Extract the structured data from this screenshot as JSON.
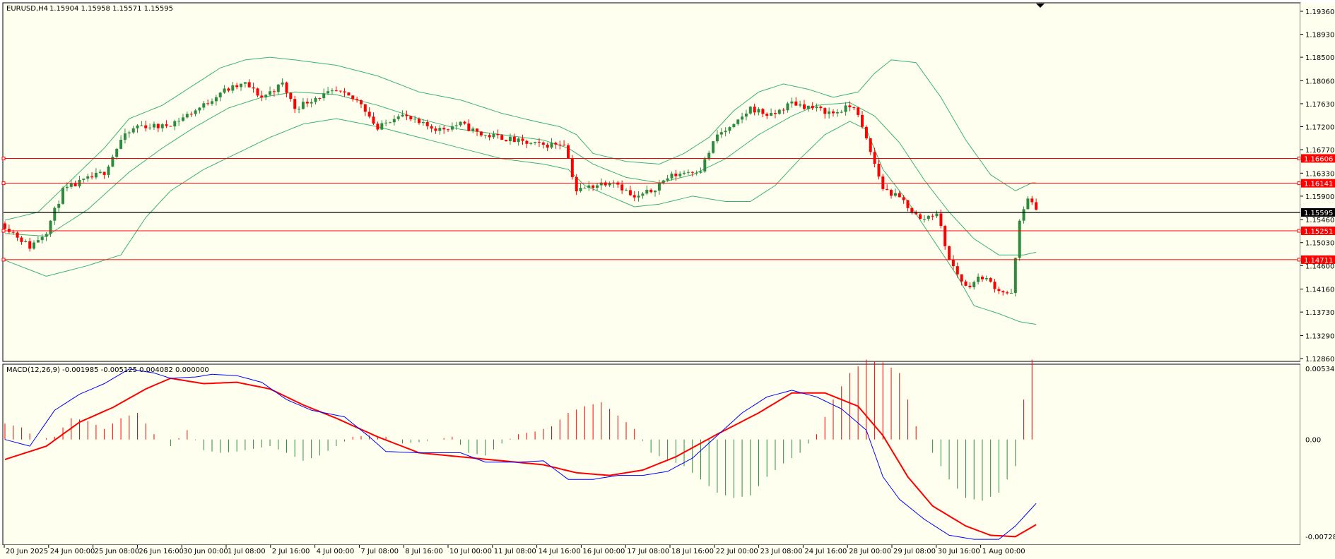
{
  "chart_data": [
    {
      "type": "candlestick",
      "title": "EURUSD,H4",
      "ohlc_readout": [
        "1.15904",
        "1.15958",
        "1.15571",
        "1.15595"
      ],
      "price_ticks": [
        "1.19360",
        "1.18930",
        "1.18500",
        "1.18060",
        "1.17630",
        "1.17200",
        "1.16770",
        "1.16330",
        "1.15900",
        "1.15460",
        "1.15030",
        "1.14600",
        "1.14160",
        "1.13730",
        "1.13290",
        "1.12860"
      ],
      "ylim": [
        1.1286,
        1.1936
      ],
      "horizontal_levels": [
        {
          "price": 1.16606,
          "label": "1.16606",
          "color": "#ff0000"
        },
        {
          "price": 1.16141,
          "label": "1.16141",
          "color": "#ff0000"
        },
        {
          "price": 1.15251,
          "label": "1.15251",
          "color": "#ff0000"
        },
        {
          "price": 1.14711,
          "label": "1.14711",
          "color": "#ff0000"
        }
      ],
      "current_price": {
        "price": 1.15595,
        "label": "1.15595",
        "color": "#000000"
      },
      "colors": {
        "up": "#2e8b3e",
        "down": "#ff0000",
        "bands": "#3cb371",
        "background": "#fffff0"
      },
      "x_labels": [
        "20 Jun 2025",
        "24 Jun 00:00",
        "25 Jun 08:00",
        "26 Jun 16:00",
        "30 Jun 00:00",
        "1 Jul 08:00",
        "2 Jul 16:00",
        "4 Jul 00:00",
        "7 Jul 08:00",
        "8 Jul 16:00",
        "10 Jul 00:00",
        "11 Jul 08:00",
        "14 Jul 16:00",
        "16 Jul 00:00",
        "17 Jul 08:00",
        "18 Jul 16:00",
        "22 Jul 00:00",
        "23 Jul 08:00",
        "24 Jul 16:00",
        "28 Jul 00:00",
        "29 Jul 08:00",
        "30 Jul 16:00",
        "1 Aug 00:00"
      ],
      "close_path": [
        [
          0,
          1.1535
        ],
        [
          6,
          1.1495
        ],
        [
          10,
          1.1525
        ],
        [
          14,
          1.16
        ],
        [
          18,
          1.1615
        ],
        [
          24,
          1.1635
        ],
        [
          28,
          1.1695
        ],
        [
          32,
          1.1722
        ],
        [
          38,
          1.172
        ],
        [
          42,
          1.1733
        ],
        [
          48,
          1.176
        ],
        [
          52,
          1.1785
        ],
        [
          58,
          1.18
        ],
        [
          62,
          1.1775
        ],
        [
          67,
          1.18
        ],
        [
          70,
          1.1755
        ],
        [
          75,
          1.1775
        ],
        [
          80,
          1.1785
        ],
        [
          86,
          1.1765
        ],
        [
          90,
          1.1715
        ],
        [
          95,
          1.1745
        ],
        [
          100,
          1.1725
        ],
        [
          105,
          1.1715
        ],
        [
          110,
          1.1725
        ],
        [
          115,
          1.1705
        ],
        [
          120,
          1.17
        ],
        [
          125,
          1.169
        ],
        [
          130,
          1.1685
        ],
        [
          135,
          1.169
        ],
        [
          138,
          1.16
        ],
        [
          142,
          1.161
        ],
        [
          147,
          1.162
        ],
        [
          152,
          1.1585
        ],
        [
          156,
          1.16
        ],
        [
          160,
          1.1625
        ],
        [
          164,
          1.1635
        ],
        [
          168,
          1.164
        ],
        [
          172,
          1.1705
        ],
        [
          176,
          1.172
        ],
        [
          180,
          1.1755
        ],
        [
          185,
          1.174
        ],
        [
          190,
          1.1765
        ],
        [
          195,
          1.1755
        ],
        [
          200,
          1.1745
        ],
        [
          205,
          1.176
        ],
        [
          208,
          1.1695
        ],
        [
          212,
          1.1605
        ],
        [
          217,
          1.158
        ],
        [
          221,
          1.1545
        ],
        [
          225,
          1.156
        ],
        [
          228,
          1.147
        ],
        [
          232,
          1.142
        ],
        [
          236,
          1.144
        ],
        [
          240,
          1.1415
        ],
        [
          243,
          1.1405
        ],
        [
          245,
          1.154
        ],
        [
          247,
          1.159
        ],
        [
          249,
          1.156
        ]
      ],
      "upper_band_path": [
        [
          0,
          1.1545
        ],
        [
          8,
          1.156
        ],
        [
          16,
          1.162
        ],
        [
          24,
          1.168
        ],
        [
          30,
          1.1735
        ],
        [
          38,
          1.176
        ],
        [
          46,
          1.18
        ],
        [
          52,
          1.183
        ],
        [
          58,
          1.1845
        ],
        [
          64,
          1.185
        ],
        [
          70,
          1.1845
        ],
        [
          80,
          1.1835
        ],
        [
          90,
          1.1815
        ],
        [
          100,
          1.1785
        ],
        [
          110,
          1.177
        ],
        [
          120,
          1.1745
        ],
        [
          128,
          1.173
        ],
        [
          134,
          1.172
        ],
        [
          138,
          1.1705
        ],
        [
          142,
          1.167
        ],
        [
          150,
          1.1655
        ],
        [
          158,
          1.165
        ],
        [
          164,
          1.167
        ],
        [
          170,
          1.17
        ],
        [
          176,
          1.175
        ],
        [
          182,
          1.1785
        ],
        [
          188,
          1.18
        ],
        [
          194,
          1.179
        ],
        [
          200,
          1.1775
        ],
        [
          206,
          1.1785
        ],
        [
          210,
          1.182
        ],
        [
          214,
          1.1845
        ],
        [
          220,
          1.184
        ],
        [
          226,
          1.1775
        ],
        [
          232,
          1.1695
        ],
        [
          238,
          1.163
        ],
        [
          244,
          1.16
        ],
        [
          248,
          1.1615
        ]
      ],
      "middle_band_path": [
        [
          0,
          1.152
        ],
        [
          10,
          1.1515
        ],
        [
          20,
          1.1565
        ],
        [
          30,
          1.1635
        ],
        [
          38,
          1.168
        ],
        [
          46,
          1.172
        ],
        [
          54,
          1.1755
        ],
        [
          62,
          1.1775
        ],
        [
          70,
          1.1785
        ],
        [
          80,
          1.178
        ],
        [
          90,
          1.176
        ],
        [
          100,
          1.1735
        ],
        [
          110,
          1.1715
        ],
        [
          120,
          1.1705
        ],
        [
          130,
          1.1695
        ],
        [
          136,
          1.168
        ],
        [
          142,
          1.165
        ],
        [
          150,
          1.1625
        ],
        [
          158,
          1.1615
        ],
        [
          166,
          1.163
        ],
        [
          174,
          1.166
        ],
        [
          182,
          1.1705
        ],
        [
          190,
          1.174
        ],
        [
          196,
          1.176
        ],
        [
          204,
          1.1765
        ],
        [
          210,
          1.174
        ],
        [
          216,
          1.169
        ],
        [
          222,
          1.162
        ],
        [
          228,
          1.156
        ],
        [
          234,
          1.151
        ],
        [
          240,
          1.148
        ],
        [
          246,
          1.148
        ],
        [
          249,
          1.1485
        ]
      ],
      "lower_band_path": [
        [
          0,
          1.147
        ],
        [
          10,
          1.144
        ],
        [
          20,
          1.146
        ],
        [
          28,
          1.148
        ],
        [
          34,
          1.155
        ],
        [
          40,
          1.16
        ],
        [
          48,
          1.164
        ],
        [
          56,
          1.167
        ],
        [
          64,
          1.17
        ],
        [
          72,
          1.1725
        ],
        [
          80,
          1.1735
        ],
        [
          90,
          1.172
        ],
        [
          100,
          1.17
        ],
        [
          110,
          1.168
        ],
        [
          120,
          1.166
        ],
        [
          130,
          1.165
        ],
        [
          136,
          1.164
        ],
        [
          140,
          1.161
        ],
        [
          146,
          1.159
        ],
        [
          152,
          1.157
        ],
        [
          158,
          1.1575
        ],
        [
          166,
          1.159
        ],
        [
          174,
          1.158
        ],
        [
          180,
          1.158
        ],
        [
          186,
          1.161
        ],
        [
          192,
          1.166
        ],
        [
          198,
          1.1705
        ],
        [
          204,
          1.173
        ],
        [
          208,
          1.1715
        ],
        [
          212,
          1.164
        ],
        [
          218,
          1.158
        ],
        [
          224,
          1.151
        ],
        [
          230,
          1.144
        ],
        [
          234,
          1.1385
        ],
        [
          240,
          1.137
        ],
        [
          245,
          1.1355
        ],
        [
          249,
          1.135
        ]
      ],
      "bar_count": 250
    },
    {
      "type": "macd",
      "title": "MACD(12,26,9) -0.001985 -0.005125 0.004082 0.000000",
      "y_ticks": [
        "0.005342",
        "0.00",
        "-0.007285"
      ],
      "ylim": [
        -0.007285,
        0.005342
      ],
      "colors": {
        "main": "#0000ff",
        "signal": "#ff0000",
        "hist_pos": "#ff0000",
        "hist_neg": "#2e8b3e"
      },
      "main_path": [
        [
          0,
          0.0
        ],
        [
          6,
          -0.0005
        ],
        [
          12,
          0.0022
        ],
        [
          18,
          0.0034
        ],
        [
          24,
          0.0042
        ],
        [
          30,
          0.0053
        ],
        [
          36,
          0.005
        ],
        [
          40,
          0.0046
        ],
        [
          46,
          0.0047
        ],
        [
          50,
          0.0049
        ],
        [
          56,
          0.0048
        ],
        [
          62,
          0.0043
        ],
        [
          68,
          0.003
        ],
        [
          74,
          0.0022
        ],
        [
          82,
          0.0017
        ],
        [
          88,
          0.0002
        ],
        [
          92,
          -0.0009
        ],
        [
          100,
          -0.001
        ],
        [
          110,
          -0.001
        ],
        [
          116,
          -0.0017
        ],
        [
          124,
          -0.0017
        ],
        [
          130,
          -0.0016
        ],
        [
          136,
          -0.003
        ],
        [
          142,
          -0.003
        ],
        [
          148,
          -0.0027
        ],
        [
          154,
          -0.0027
        ],
        [
          160,
          -0.0024
        ],
        [
          166,
          -0.0014
        ],
        [
          172,
          0.0003
        ],
        [
          178,
          0.002
        ],
        [
          184,
          0.0032
        ],
        [
          190,
          0.0037
        ],
        [
          196,
          0.0032
        ],
        [
          202,
          0.0023
        ],
        [
          208,
          0.0007
        ],
        [
          212,
          -0.0028
        ],
        [
          216,
          -0.0045
        ],
        [
          222,
          -0.006
        ],
        [
          228,
          -0.0072
        ],
        [
          234,
          -0.0075
        ],
        [
          240,
          -0.0075
        ],
        [
          244,
          -0.0065
        ],
        [
          249,
          -0.0048
        ]
      ],
      "signal_path": [
        [
          0,
          -0.0015
        ],
        [
          10,
          -0.0005
        ],
        [
          18,
          0.0013
        ],
        [
          26,
          0.0024
        ],
        [
          34,
          0.0038
        ],
        [
          40,
          0.0046
        ],
        [
          48,
          0.0042
        ],
        [
          56,
          0.0043
        ],
        [
          64,
          0.0038
        ],
        [
          72,
          0.0026
        ],
        [
          80,
          0.0016
        ],
        [
          90,
          0.0002
        ],
        [
          100,
          -0.001
        ],
        [
          110,
          -0.0013
        ],
        [
          120,
          -0.0016
        ],
        [
          130,
          -0.0019
        ],
        [
          138,
          -0.0025
        ],
        [
          146,
          -0.0027
        ],
        [
          154,
          -0.0023
        ],
        [
          162,
          -0.0013
        ],
        [
          172,
          0.0004
        ],
        [
          182,
          0.002
        ],
        [
          190,
          0.0035
        ],
        [
          198,
          0.0035
        ],
        [
          206,
          0.0025
        ],
        [
          212,
          0.0003
        ],
        [
          218,
          -0.0028
        ],
        [
          224,
          -0.005
        ],
        [
          232,
          -0.0065
        ],
        [
          238,
          -0.0072
        ],
        [
          244,
          -0.0073
        ],
        [
          249,
          -0.0064
        ]
      ],
      "histogram": [
        [
          0,
          0.0012
        ],
        [
          4,
          0.0009
        ],
        [
          8,
          0.0
        ],
        [
          12,
          0.0002
        ],
        [
          16,
          0.0016
        ],
        [
          20,
          0.0014
        ],
        [
          24,
          0.0008
        ],
        [
          28,
          0.0016
        ],
        [
          32,
          0.002
        ],
        [
          36,
          0.0004
        ],
        [
          40,
          -0.0005
        ],
        [
          44,
          0.0007
        ],
        [
          48,
          -0.0008
        ],
        [
          52,
          -0.001
        ],
        [
          56,
          -0.0009
        ],
        [
          60,
          -0.0007
        ],
        [
          64,
          -0.0005
        ],
        [
          68,
          -0.001
        ],
        [
          72,
          -0.0016
        ],
        [
          76,
          -0.0012
        ],
        [
          80,
          -0.0005
        ],
        [
          84,
          0.0002
        ],
        [
          88,
          0.0003
        ],
        [
          92,
          0.0002
        ],
        [
          96,
          -0.0003
        ],
        [
          100,
          -0.0002
        ],
        [
          104,
          0.0
        ],
        [
          108,
          0.0002
        ],
        [
          112,
          -0.001
        ],
        [
          116,
          -0.0012
        ],
        [
          120,
          -0.0003
        ],
        [
          124,
          0.0004
        ],
        [
          128,
          0.0006
        ],
        [
          132,
          0.001
        ],
        [
          136,
          0.002
        ],
        [
          140,
          0.0025
        ],
        [
          144,
          0.0028
        ],
        [
          148,
          0.0018
        ],
        [
          152,
          0.0008
        ],
        [
          156,
          -0.001
        ],
        [
          160,
          -0.0015
        ],
        [
          164,
          -0.002
        ],
        [
          168,
          -0.003
        ],
        [
          172,
          -0.004
        ],
        [
          176,
          -0.0044
        ],
        [
          180,
          -0.0042
        ],
        [
          184,
          -0.0028
        ],
        [
          188,
          -0.0018
        ],
        [
          192,
          -0.001
        ],
        [
          196,
          0.0004
        ],
        [
          200,
          0.003
        ],
        [
          204,
          0.005
        ],
        [
          208,
          0.006
        ],
        [
          212,
          0.0058
        ],
        [
          216,
          0.005
        ],
        [
          220,
          0.001
        ],
        [
          224,
          -0.001
        ],
        [
          228,
          -0.003
        ],
        [
          232,
          -0.0044
        ],
        [
          236,
          -0.0046
        ],
        [
          240,
          -0.004
        ],
        [
          244,
          -0.002
        ],
        [
          246,
          0.003
        ],
        [
          248,
          0.006
        ],
        [
          249,
          0.0068
        ]
      ]
    }
  ]
}
